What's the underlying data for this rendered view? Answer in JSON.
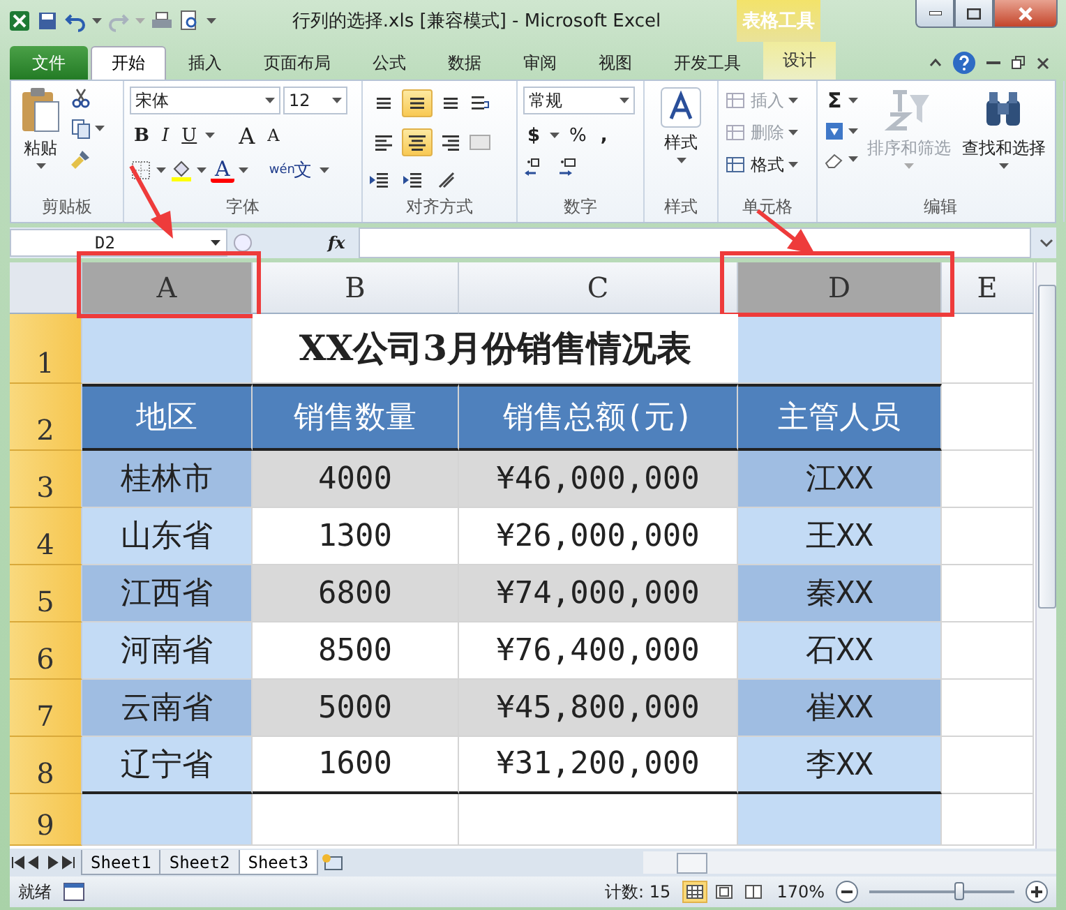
{
  "window": {
    "title": "行列的选择.xls  [兼容模式]  -  Microsoft Excel",
    "context_group": "表格工具"
  },
  "ribbon_tabs": [
    {
      "label": "文件",
      "kind": "file",
      "selected": false
    },
    {
      "label": "开始",
      "kind": "normal",
      "selected": true
    },
    {
      "label": "插入",
      "kind": "normal",
      "selected": false
    },
    {
      "label": "页面布局",
      "kind": "normal",
      "selected": false
    },
    {
      "label": "公式",
      "kind": "normal",
      "selected": false
    },
    {
      "label": "数据",
      "kind": "normal",
      "selected": false
    },
    {
      "label": "审阅",
      "kind": "normal",
      "selected": false
    },
    {
      "label": "视图",
      "kind": "normal",
      "selected": false
    },
    {
      "label": "开发工具",
      "kind": "normal",
      "selected": false
    },
    {
      "label": "设计",
      "kind": "context",
      "selected": false
    }
  ],
  "ribbon_groups": [
    {
      "kind": "clipboard",
      "label": "剪贴板",
      "paste": "粘贴"
    },
    {
      "kind": "font",
      "label": "字体",
      "font_name": "宋体",
      "font_size": "12",
      "bold": "B",
      "italic": "I",
      "underline": "U",
      "grow": "A",
      "shrink": "A",
      "color_glyph": "A",
      "phonetic_ruby": "wén",
      "phonetic": "文"
    },
    {
      "kind": "alignment",
      "label": "对齐方式",
      "buttons": [
        {
          "kind": "top",
          "selected": false
        },
        {
          "kind": "middle",
          "selected": true
        },
        {
          "kind": "bottom",
          "selected": false
        },
        {
          "kind": "left",
          "selected": false
        },
        {
          "kind": "center",
          "selected": true
        },
        {
          "kind": "right",
          "selected": false
        }
      ]
    },
    {
      "kind": "number",
      "label": "数字",
      "format": "常规",
      "currency": "$",
      "percent": "%",
      "comma": ","
    },
    {
      "kind": "styles",
      "label": "样式",
      "button": "样式"
    },
    {
      "kind": "cells",
      "label": "单元格",
      "items": [
        {
          "label": "插入",
          "disabled": true
        },
        {
          "label": "删除",
          "disabled": true
        },
        {
          "label": "格式",
          "disabled": false
        }
      ]
    },
    {
      "kind": "editing",
      "label": "编辑",
      "sum": "Σ",
      "sort": {
        "label": "排序和筛选",
        "disabled": true
      },
      "find": {
        "label": "查找和选择",
        "disabled": false
      }
    }
  ],
  "formula_bar": {
    "name_box": "D2",
    "fx": "fx"
  },
  "sheet": {
    "columns": [
      {
        "label": "A",
        "selected": true
      },
      {
        "label": "B",
        "selected": false
      },
      {
        "label": "C",
        "selected": false
      },
      {
        "label": "D",
        "selected": true
      },
      {
        "label": "E",
        "selected": false
      }
    ],
    "rows": [
      {
        "header": "1",
        "selected": true,
        "kind": "title",
        "title": "XX公司3月份销售情况表"
      },
      {
        "header": "2",
        "selected": true,
        "kind": "header",
        "cells": [
          "地区",
          "销售数量",
          "销售总额(元)",
          "主管人员"
        ]
      },
      {
        "header": "3",
        "selected": true,
        "kind": "data",
        "shaded": true,
        "cells": [
          "桂林市",
          "4000",
          "¥46,000,000",
          "江XX"
        ]
      },
      {
        "header": "4",
        "selected": true,
        "kind": "data",
        "shaded": false,
        "cells": [
          "山东省",
          "1300",
          "¥26,000,000",
          "王XX"
        ]
      },
      {
        "header": "5",
        "selected": true,
        "kind": "data",
        "shaded": true,
        "cells": [
          "江西省",
          "6800",
          "¥74,000,000",
          "秦XX"
        ]
      },
      {
        "header": "6",
        "selected": true,
        "kind": "data",
        "shaded": false,
        "cells": [
          "河南省",
          "8500",
          "¥76,400,000",
          "石XX"
        ]
      },
      {
        "header": "7",
        "selected": true,
        "kind": "data",
        "shaded": true,
        "cells": [
          "云南省",
          "5000",
          "¥45,800,000",
          "崔XX"
        ]
      },
      {
        "header": "8",
        "selected": true,
        "kind": "data",
        "shaded": false,
        "cells": [
          "辽宁省",
          "1600",
          "¥31,200,000",
          "李XX"
        ]
      },
      {
        "header": "9",
        "selected": true,
        "kind": "empty"
      }
    ]
  },
  "sheet_tabs": [
    {
      "label": "Sheet1",
      "selected": false
    },
    {
      "label": "Sheet2",
      "selected": false
    },
    {
      "label": "Sheet3",
      "selected": true
    }
  ],
  "status_bar": {
    "mode": "就绪",
    "count": "计数: 15",
    "views": [
      {
        "kind": "normal",
        "selected": true
      },
      {
        "kind": "layout",
        "selected": false
      },
      {
        "kind": "pagebreak",
        "selected": false
      }
    ],
    "zoom": "170%",
    "zoom_slider": {
      "level": 0.62
    }
  }
}
